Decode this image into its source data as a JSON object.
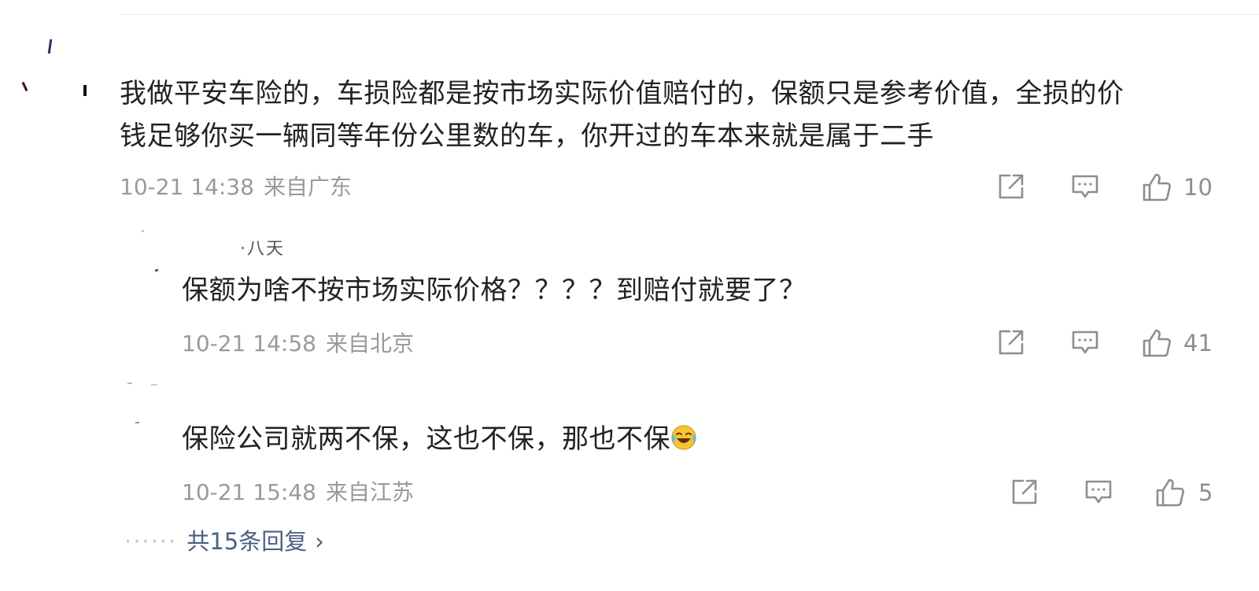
{
  "comments": [
    {
      "text_line1": "我做平安车险的，车损险都是按市场实际价值赔付的，保额只是参考价值，全损的价",
      "text_line2": "钱足够你买一辆同等年份公里数的车，你开过的车本来就是属于二手",
      "time": "10-21 14:38",
      "location": "来自广东",
      "likes": "10"
    },
    {
      "text": "保额为啥不按市场实际价格？？？？到赔付就要了？",
      "time": "10-21 14:58",
      "location": "来自北京",
      "likes": "41"
    },
    {
      "text": "保险公司就两不保，这也不保，那也不保",
      "time": "10-21 15:48",
      "location": "来自江苏",
      "likes": "5"
    }
  ],
  "icons": {
    "share": "share-icon",
    "reply": "comment-icon",
    "like": "thumbs-up-icon",
    "emoji": "laughing-crying-emoji-icon"
  },
  "more_replies": {
    "label": "共15条回复",
    "chevron": "›"
  },
  "colors": {
    "text": "#222222",
    "meta": "#9a9a9a",
    "link": "#4b5f83",
    "divider": "#ececec"
  }
}
